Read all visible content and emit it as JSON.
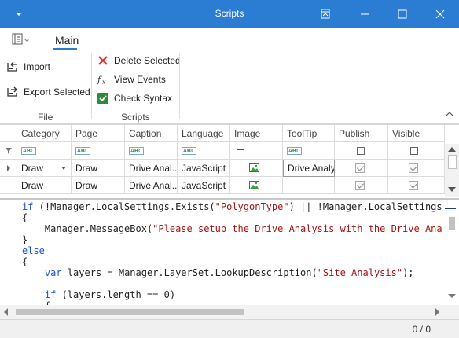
{
  "window": {
    "title": "Scripts"
  },
  "ribbon": {
    "tab": "Main",
    "file_group": {
      "label": "File",
      "import": "Import",
      "export_selected": "Export Selected"
    },
    "scripts_group": {
      "label": "Scripts",
      "delete_selected": "Delete Selected",
      "view_events": "View Events",
      "check_syntax": "Check Syntax"
    }
  },
  "grid": {
    "columns": [
      "Category",
      "Page",
      "Caption",
      "Language",
      "Image",
      "ToolTip",
      "Publish",
      "Visible"
    ],
    "rows": [
      {
        "category": "Draw",
        "page": "Draw",
        "caption": "Drive Anal...",
        "language": "JavaScript",
        "tooltip": "Drive Analy",
        "publish": true,
        "visible": true
      },
      {
        "category": "Draw",
        "page": "Draw",
        "caption": "Drive Anal...",
        "language": "JavaScript",
        "tooltip": "",
        "publish": true,
        "visible": true
      }
    ]
  },
  "editor": {
    "lines": [
      [
        {
          "t": "if (!Manager.LocalSettings.Exists(",
          "c": "kw0"
        },
        {
          "t": "\"PolygonType\"",
          "c": "str"
        },
        {
          "t": ") || !Manager.LocalSettings.Exi",
          "c": ""
        }
      ],
      [
        {
          "t": "{",
          "c": ""
        }
      ],
      [
        {
          "t": "    Manager.MessageBox(",
          "c": ""
        },
        {
          "t": "\"Please setup the Drive Analysis with the Drive Analysi",
          "c": "str"
        }
      ],
      [
        {
          "t": "}",
          "c": ""
        }
      ],
      [
        {
          "t": "else",
          "c": "kw"
        }
      ],
      [
        {
          "t": "{",
          "c": ""
        }
      ],
      [
        {
          "t": "    ",
          "c": ""
        },
        {
          "t": "var",
          "c": "kw"
        },
        {
          "t": " layers = Manager.LayerSet.LookupDescription(",
          "c": ""
        },
        {
          "t": "\"Site Analysis\"",
          "c": "str"
        },
        {
          "t": ");",
          "c": ""
        }
      ],
      [
        {
          "t": "",
          "c": ""
        }
      ],
      [
        {
          "t": "    ",
          "c": ""
        },
        {
          "t": "if",
          "c": "kw"
        },
        {
          "t": " (layers.length == 0)",
          "c": ""
        }
      ],
      [
        {
          "t": "    {",
          "c": ""
        }
      ]
    ]
  },
  "status": {
    "count": "0 / 0"
  },
  "colors": {
    "accent": "#2b7cd3",
    "keyword": "#1a55c9",
    "string": "#a31515"
  }
}
